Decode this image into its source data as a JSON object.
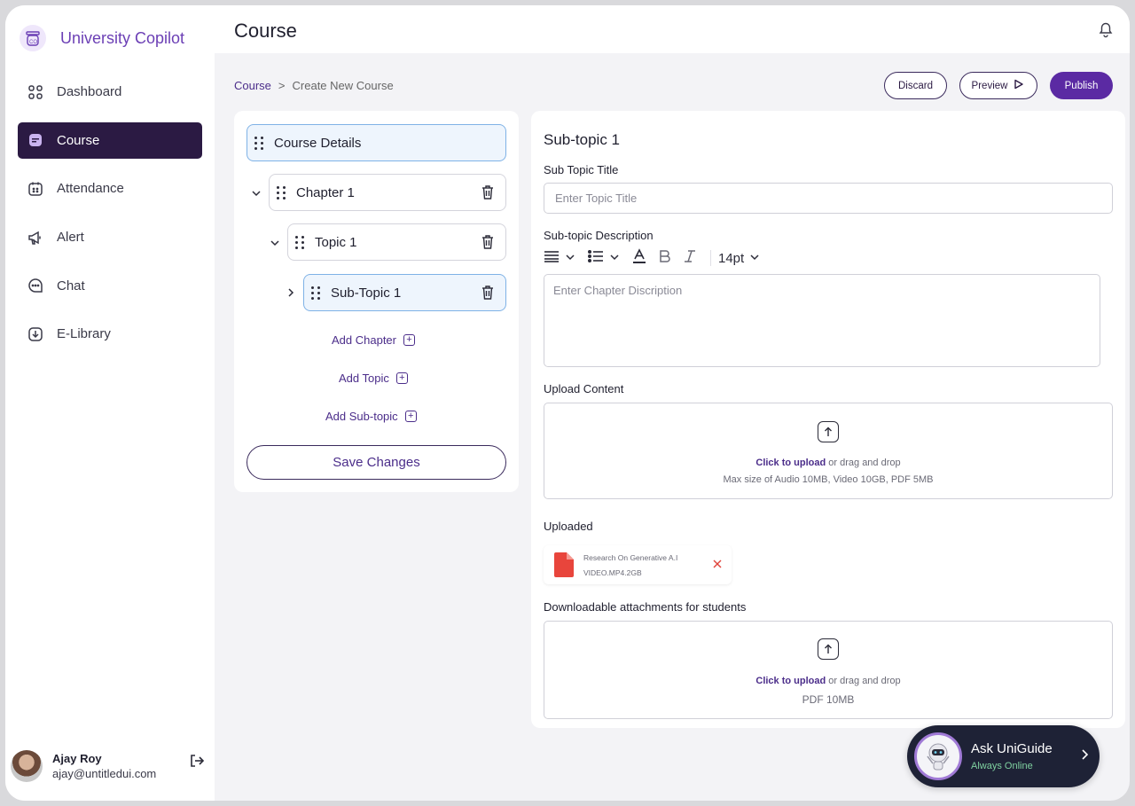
{
  "app": {
    "name": "University Copilot"
  },
  "sidebar": {
    "items": [
      {
        "label": "Dashboard",
        "icon": "dashboard-icon",
        "active": false
      },
      {
        "label": "Course",
        "icon": "course-icon",
        "active": true
      },
      {
        "label": "Attendance",
        "icon": "calendar-icon",
        "active": false
      },
      {
        "label": "Alert",
        "icon": "megaphone-icon",
        "active": false
      },
      {
        "label": "Chat",
        "icon": "chat-icon",
        "active": false
      },
      {
        "label": "E-Library",
        "icon": "download-icon",
        "active": false
      }
    ]
  },
  "user": {
    "name": "Ajay Roy",
    "email": "ajay@untitledui.com"
  },
  "header": {
    "title": "Course"
  },
  "breadcrumb": {
    "root": "Course",
    "separator": ">",
    "current": "Create New Course"
  },
  "actions": {
    "discard": "Discard",
    "preview": "Preview",
    "publish": "Publish"
  },
  "tree": {
    "course_details": "Course Details",
    "chapter": "Chapter 1",
    "topic": "Topic 1",
    "subtopic": "Sub-Topic 1",
    "add_chapter": "Add Chapter",
    "add_topic": "Add Topic",
    "add_subtopic": "Add Sub-topic",
    "save": "Save Changes"
  },
  "form": {
    "title": "Sub-topic 1",
    "subtopic_title_label": "Sub Topic Title",
    "subtopic_title_placeholder": "Enter Topic Title",
    "description_label": "Sub-topic Description",
    "font_size": "14pt",
    "description_placeholder": "Enter Chapter Discription",
    "upload_label": "Upload Content",
    "upload_click": "Click to upload",
    "upload_or": "or drag and drop",
    "upload_limits": "Max size of Audio 10MB, Video 10GB, PDF 5MB",
    "uploaded_label": "Uploaded",
    "uploaded_file": {
      "name": "Research On Generative A.I",
      "meta": "VIDEO.MP4.2GB"
    },
    "attachments_label": "Downloadable attachments for students",
    "attach_click": "Click to upload",
    "attach_or": "or drag and drop",
    "attach_limits": "PDF 10MB"
  },
  "assistant": {
    "title": "Ask UniGuide",
    "status": "Always Online"
  },
  "colors": {
    "primary": "#5b2aa3",
    "active_nav": "#2b1a43",
    "accent_link": "#4b2d8a",
    "file_red": "#e8453c",
    "online_green": "#7fd1a0"
  }
}
